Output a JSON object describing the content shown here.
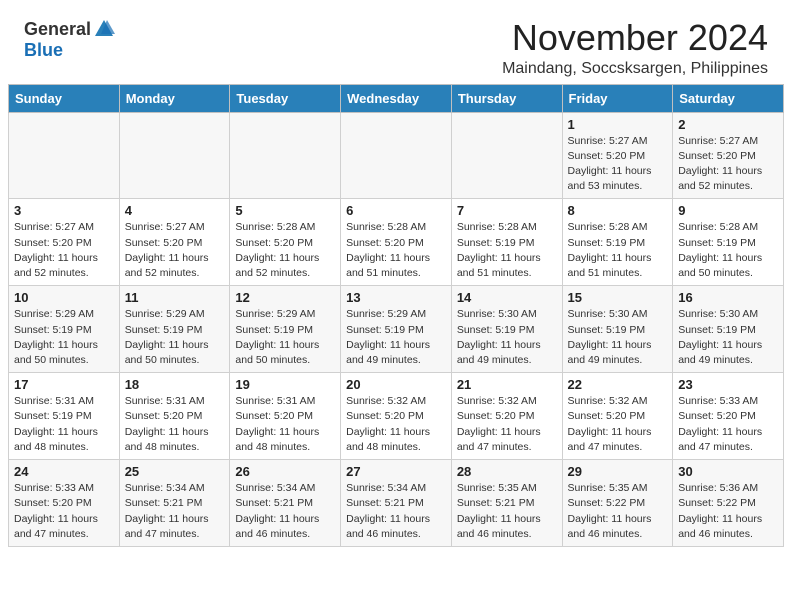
{
  "header": {
    "logo_general": "General",
    "logo_blue": "Blue",
    "month": "November 2024",
    "location": "Maindang, Soccsksargen, Philippines"
  },
  "days_of_week": [
    "Sunday",
    "Monday",
    "Tuesday",
    "Wednesday",
    "Thursday",
    "Friday",
    "Saturday"
  ],
  "weeks": [
    [
      {
        "day": "",
        "content": ""
      },
      {
        "day": "",
        "content": ""
      },
      {
        "day": "",
        "content": ""
      },
      {
        "day": "",
        "content": ""
      },
      {
        "day": "",
        "content": ""
      },
      {
        "day": "1",
        "content": "Sunrise: 5:27 AM\nSunset: 5:20 PM\nDaylight: 11 hours\nand 53 minutes."
      },
      {
        "day": "2",
        "content": "Sunrise: 5:27 AM\nSunset: 5:20 PM\nDaylight: 11 hours\nand 52 minutes."
      }
    ],
    [
      {
        "day": "3",
        "content": "Sunrise: 5:27 AM\nSunset: 5:20 PM\nDaylight: 11 hours\nand 52 minutes."
      },
      {
        "day": "4",
        "content": "Sunrise: 5:27 AM\nSunset: 5:20 PM\nDaylight: 11 hours\nand 52 minutes."
      },
      {
        "day": "5",
        "content": "Sunrise: 5:28 AM\nSunset: 5:20 PM\nDaylight: 11 hours\nand 52 minutes."
      },
      {
        "day": "6",
        "content": "Sunrise: 5:28 AM\nSunset: 5:20 PM\nDaylight: 11 hours\nand 51 minutes."
      },
      {
        "day": "7",
        "content": "Sunrise: 5:28 AM\nSunset: 5:19 PM\nDaylight: 11 hours\nand 51 minutes."
      },
      {
        "day": "8",
        "content": "Sunrise: 5:28 AM\nSunset: 5:19 PM\nDaylight: 11 hours\nand 51 minutes."
      },
      {
        "day": "9",
        "content": "Sunrise: 5:28 AM\nSunset: 5:19 PM\nDaylight: 11 hours\nand 50 minutes."
      }
    ],
    [
      {
        "day": "10",
        "content": "Sunrise: 5:29 AM\nSunset: 5:19 PM\nDaylight: 11 hours\nand 50 minutes."
      },
      {
        "day": "11",
        "content": "Sunrise: 5:29 AM\nSunset: 5:19 PM\nDaylight: 11 hours\nand 50 minutes."
      },
      {
        "day": "12",
        "content": "Sunrise: 5:29 AM\nSunset: 5:19 PM\nDaylight: 11 hours\nand 50 minutes."
      },
      {
        "day": "13",
        "content": "Sunrise: 5:29 AM\nSunset: 5:19 PM\nDaylight: 11 hours\nand 49 minutes."
      },
      {
        "day": "14",
        "content": "Sunrise: 5:30 AM\nSunset: 5:19 PM\nDaylight: 11 hours\nand 49 minutes."
      },
      {
        "day": "15",
        "content": "Sunrise: 5:30 AM\nSunset: 5:19 PM\nDaylight: 11 hours\nand 49 minutes."
      },
      {
        "day": "16",
        "content": "Sunrise: 5:30 AM\nSunset: 5:19 PM\nDaylight: 11 hours\nand 49 minutes."
      }
    ],
    [
      {
        "day": "17",
        "content": "Sunrise: 5:31 AM\nSunset: 5:19 PM\nDaylight: 11 hours\nand 48 minutes."
      },
      {
        "day": "18",
        "content": "Sunrise: 5:31 AM\nSunset: 5:20 PM\nDaylight: 11 hours\nand 48 minutes."
      },
      {
        "day": "19",
        "content": "Sunrise: 5:31 AM\nSunset: 5:20 PM\nDaylight: 11 hours\nand 48 minutes."
      },
      {
        "day": "20",
        "content": "Sunrise: 5:32 AM\nSunset: 5:20 PM\nDaylight: 11 hours\nand 48 minutes."
      },
      {
        "day": "21",
        "content": "Sunrise: 5:32 AM\nSunset: 5:20 PM\nDaylight: 11 hours\nand 47 minutes."
      },
      {
        "day": "22",
        "content": "Sunrise: 5:32 AM\nSunset: 5:20 PM\nDaylight: 11 hours\nand 47 minutes."
      },
      {
        "day": "23",
        "content": "Sunrise: 5:33 AM\nSunset: 5:20 PM\nDaylight: 11 hours\nand 47 minutes."
      }
    ],
    [
      {
        "day": "24",
        "content": "Sunrise: 5:33 AM\nSunset: 5:20 PM\nDaylight: 11 hours\nand 47 minutes."
      },
      {
        "day": "25",
        "content": "Sunrise: 5:34 AM\nSunset: 5:21 PM\nDaylight: 11 hours\nand 47 minutes."
      },
      {
        "day": "26",
        "content": "Sunrise: 5:34 AM\nSunset: 5:21 PM\nDaylight: 11 hours\nand 46 minutes."
      },
      {
        "day": "27",
        "content": "Sunrise: 5:34 AM\nSunset: 5:21 PM\nDaylight: 11 hours\nand 46 minutes."
      },
      {
        "day": "28",
        "content": "Sunrise: 5:35 AM\nSunset: 5:21 PM\nDaylight: 11 hours\nand 46 minutes."
      },
      {
        "day": "29",
        "content": "Sunrise: 5:35 AM\nSunset: 5:22 PM\nDaylight: 11 hours\nand 46 minutes."
      },
      {
        "day": "30",
        "content": "Sunrise: 5:36 AM\nSunset: 5:22 PM\nDaylight: 11 hours\nand 46 minutes."
      }
    ]
  ]
}
